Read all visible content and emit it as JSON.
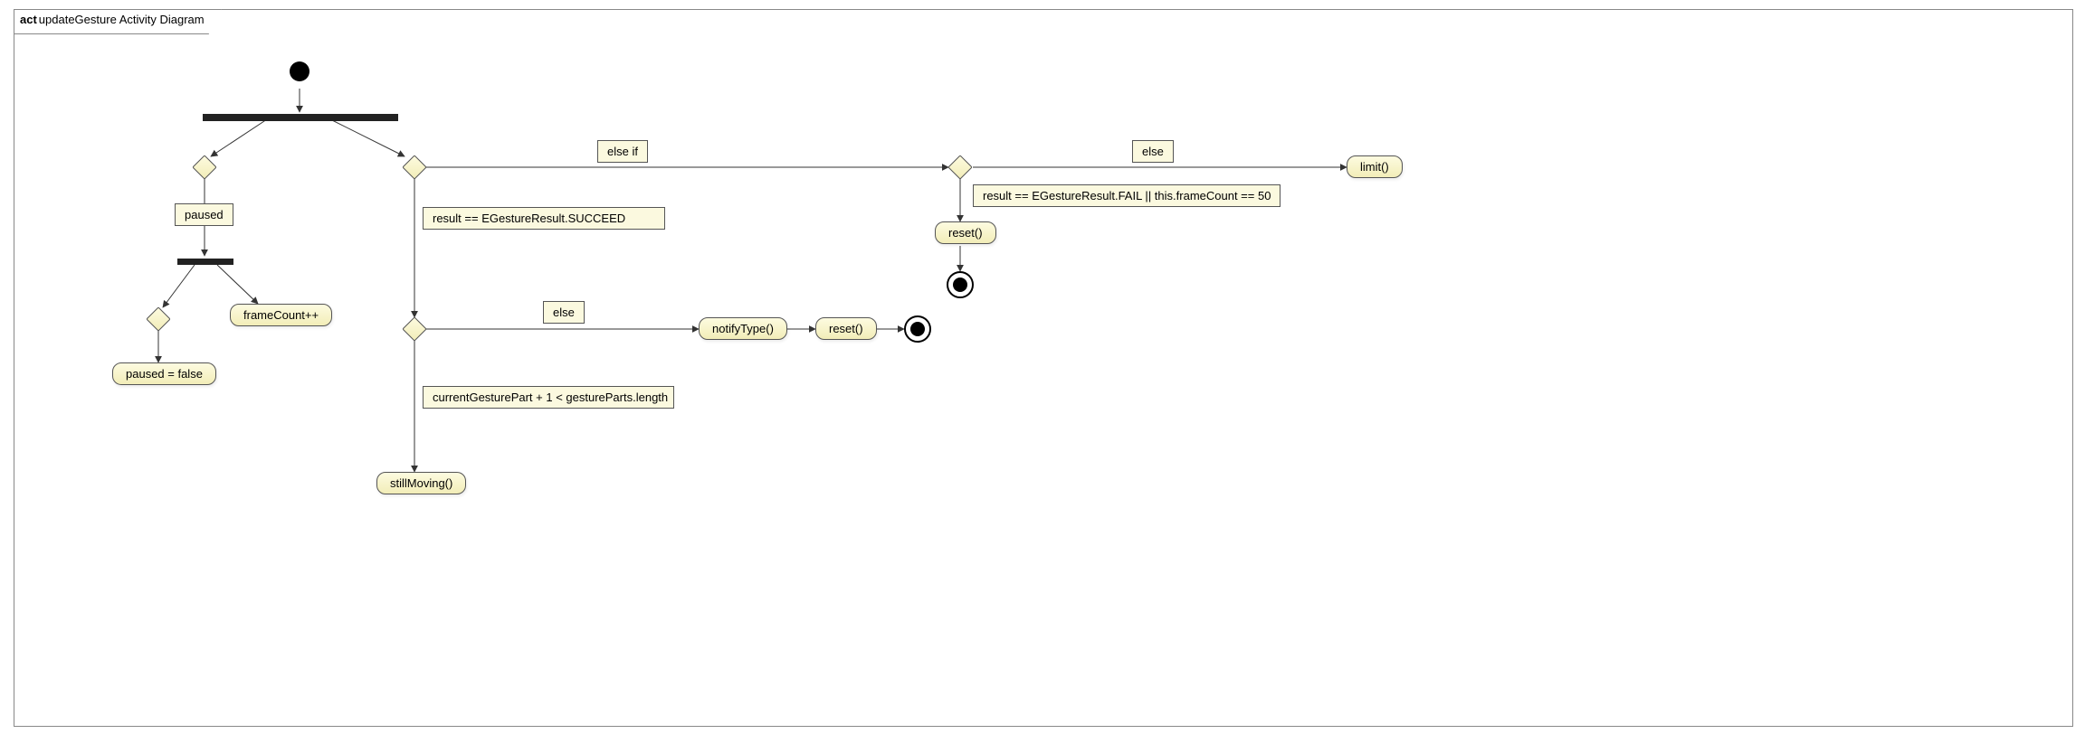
{
  "frame": {
    "prefix": "act",
    "title": "updateGesture Activity Diagram"
  },
  "guards": {
    "paused": "paused",
    "succeed": "result == EGestureResult.SUCCEED",
    "elseif": "else if",
    "else1": "else",
    "fail": "result == EGestureResult.FAIL || this.frameCount == 50",
    "moreParts": "currentGesturePart + 1 < gestureParts.length",
    "else2": "else"
  },
  "activities": {
    "frameCount": "frameCount++",
    "pausedFalse": "paused = false",
    "stillMoving": "stillMoving()",
    "notifyType": "notifyType()",
    "reset1": "reset()",
    "reset2": "reset()",
    "limit": "limit()"
  }
}
